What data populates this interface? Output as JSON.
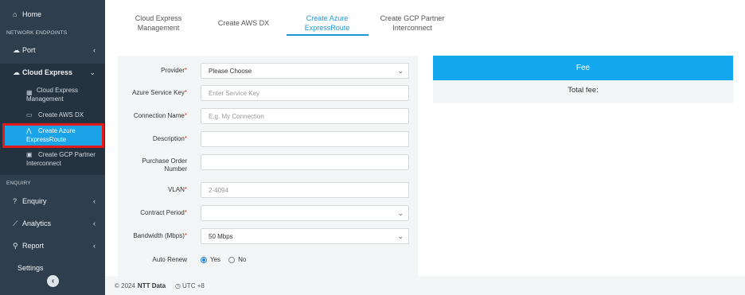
{
  "sidebar": {
    "home": {
      "icon": "home-icon",
      "label": "Home"
    },
    "section_network": "NETWORK ENDPOINTS",
    "port": {
      "icon": "cloud-icon",
      "label": "Port"
    },
    "cloud_express": {
      "icon": "cloud-icon",
      "label": "Cloud Express"
    },
    "sub_items": [
      {
        "icon": "grid-icon",
        "label_line1": "Cloud Express",
        "label_line2": "Management"
      },
      {
        "icon": "aws-icon",
        "label_line1": "Create AWS DX",
        "label_line2": ""
      },
      {
        "icon": "azure-icon",
        "label_line1": "Create Azure",
        "label_line2": "ExpressRoute"
      },
      {
        "icon": "gcp-icon",
        "label_line1": "Create GCP Partner",
        "label_line2": "Interconnect"
      }
    ],
    "section_enquiry": "ENQUIRY",
    "enquiry": {
      "icon": "help-circle-icon",
      "label": "Enquiry"
    },
    "analytics": {
      "icon": "chart-icon",
      "label": "Analytics"
    },
    "report": {
      "icon": "search-icon",
      "label": "Report"
    },
    "settings": {
      "label": "Settings"
    }
  },
  "tabs": [
    {
      "line1": "Cloud Express",
      "line2": "Management"
    },
    {
      "line1": "Create AWS DX",
      "line2": ""
    },
    {
      "line1": "Create Azure",
      "line2": "ExpressRoute"
    },
    {
      "line1": "Create GCP Partner",
      "line2": "Interconnect"
    }
  ],
  "form": {
    "provider": {
      "label": "Provider",
      "value": "Please Choose"
    },
    "service_key": {
      "label": "Azure Service Key",
      "placeholder": "Enter Service Key"
    },
    "connection_name": {
      "label": "Connection Name",
      "placeholder": "E.g. My Connection"
    },
    "description": {
      "label": "Description"
    },
    "po_number": {
      "label_line1": "Purchase Order",
      "label_line2": "Number"
    },
    "vlan": {
      "label": "VLAN",
      "placeholder": "2-4094"
    },
    "contract_period": {
      "label": "Contract Period",
      "value": ""
    },
    "bandwidth": {
      "label": "Bandwidth (Mbps)",
      "value": "50 Mbps"
    },
    "auto_renew": {
      "label": "Auto Renew",
      "yes": "Yes",
      "no": "No"
    },
    "required_mark": "*"
  },
  "fee": {
    "header": "Fee",
    "total_label": "Total fee:"
  },
  "footer": {
    "copyright": "© 2024",
    "company": "NTT Data",
    "timezone": "UTC +8"
  },
  "colors": {
    "sidebar_bg": "#2f3e4d",
    "accent": "#1ba3e8",
    "highlight_border": "#e21a1a"
  }
}
